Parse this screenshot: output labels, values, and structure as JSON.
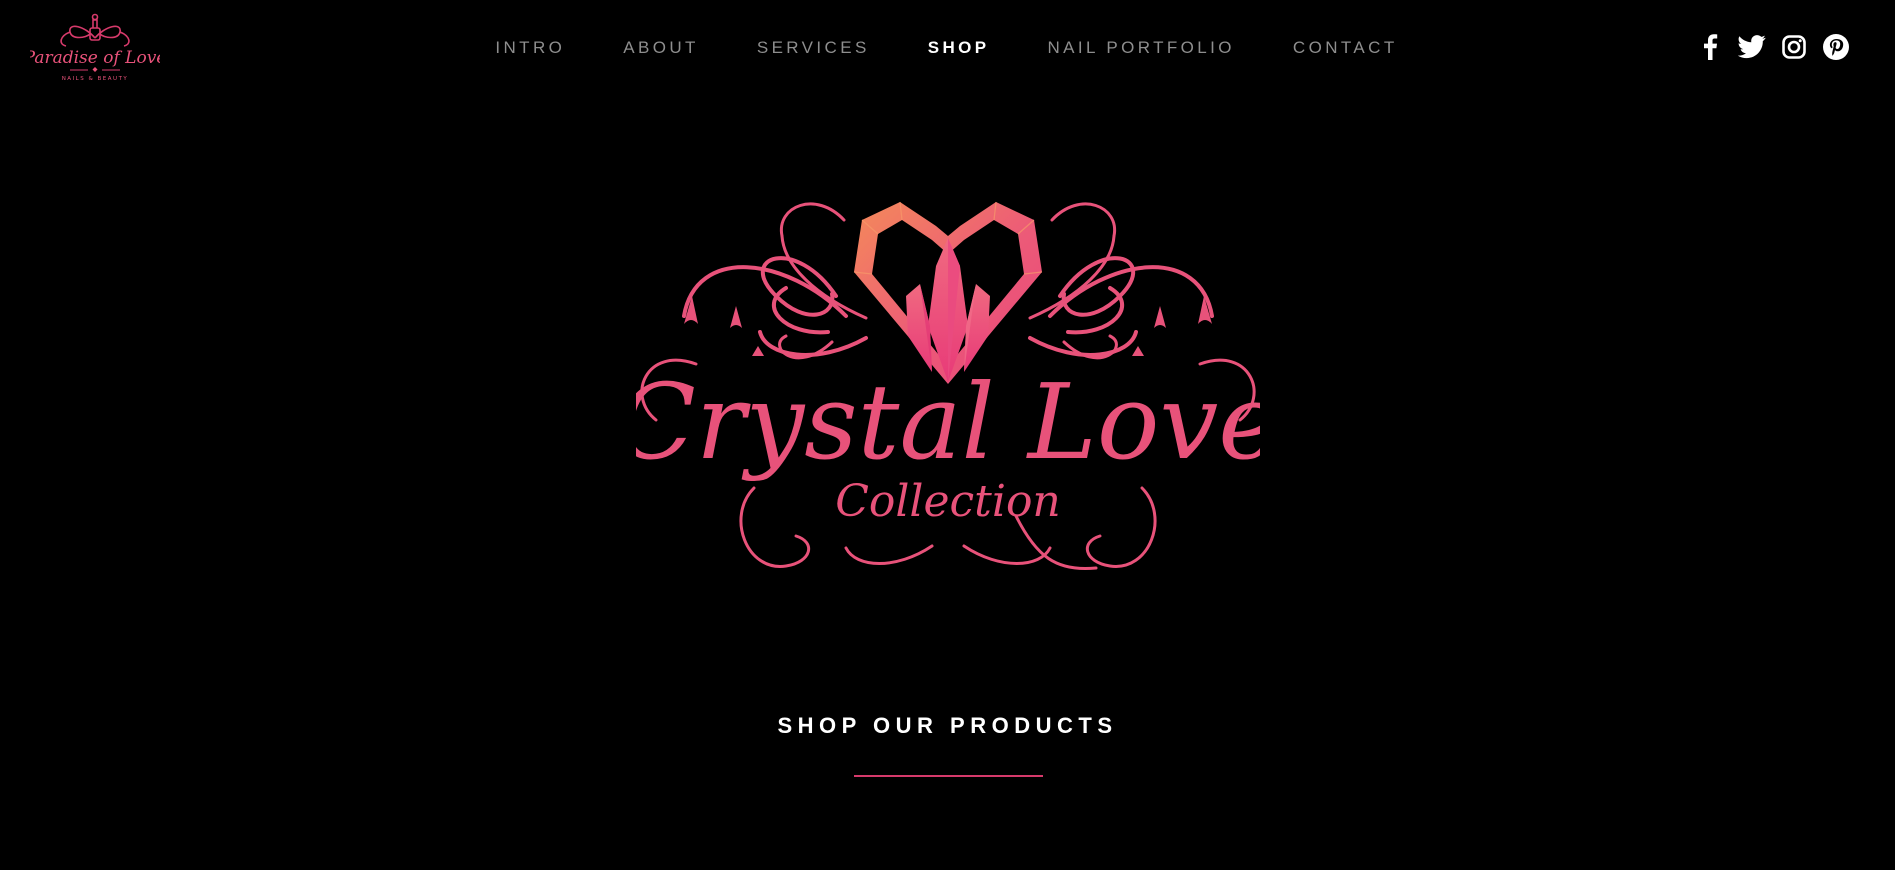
{
  "colors": {
    "background": "#000000",
    "accent": "#e8527a",
    "accent_dark": "#d63a6b",
    "accent_orange": "#f17a5a",
    "nav_inactive": "#8e8e8e",
    "nav_active": "#ffffff"
  },
  "header": {
    "logo": {
      "title": "Paradise of Love",
      "subtitle": "NAILS & BEAUTY"
    },
    "nav": [
      {
        "label": "INTRO",
        "active": false
      },
      {
        "label": "ABOUT",
        "active": false
      },
      {
        "label": "SERVICES",
        "active": false
      },
      {
        "label": "SHOP",
        "active": true
      },
      {
        "label": "NAIL PORTFOLIO",
        "active": false
      },
      {
        "label": "CONTACT",
        "active": false
      }
    ],
    "social": [
      {
        "icon": "facebook-icon"
      },
      {
        "icon": "twitter-icon"
      },
      {
        "icon": "instagram-icon"
      },
      {
        "icon": "pinterest-icon"
      }
    ]
  },
  "hero": {
    "brand_logo": {
      "title": "Crystal Love",
      "subtitle": "Collection"
    }
  },
  "section": {
    "title": "SHOP OUR PRODUCTS"
  }
}
